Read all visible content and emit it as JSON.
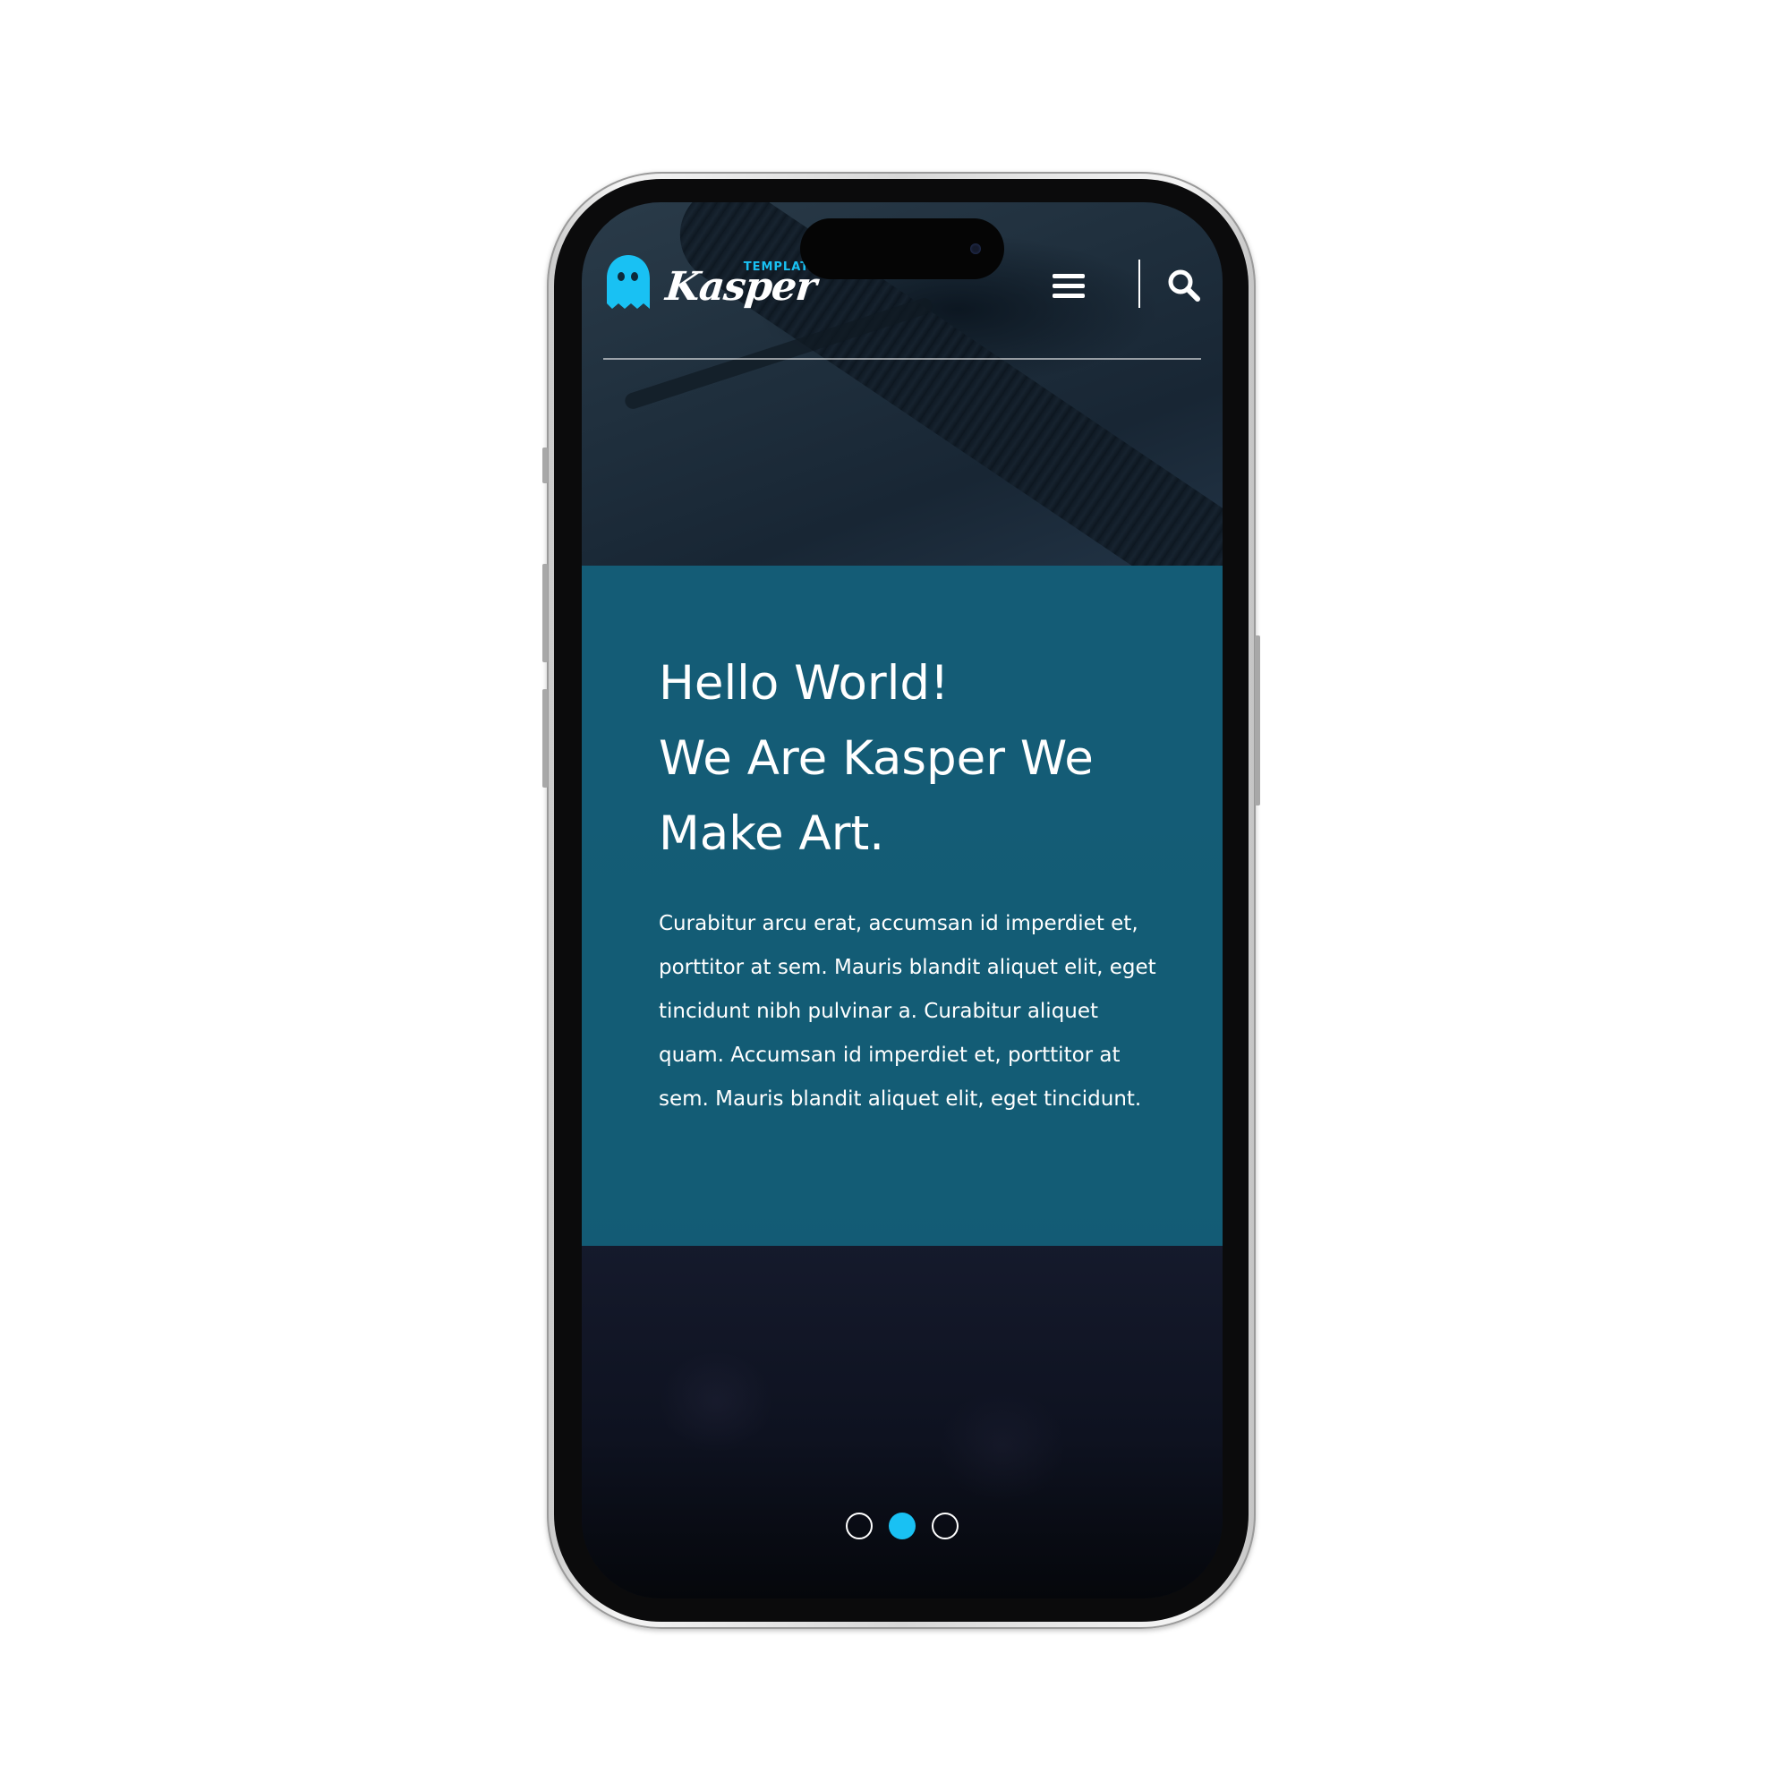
{
  "header": {
    "logo_main": "Kasper",
    "logo_sub": "TEMPLATE",
    "menu_icon": "hamburger-menu-icon",
    "search_icon": "search-icon"
  },
  "hero": {
    "title_lines": [
      "Hello World!",
      "We Are Kasper We",
      "Make Art."
    ],
    "description": "Curabitur arcu erat, accumsan id imperdiet et, porttitor at sem. Mauris blandit aliquet elit, eget tincidunt nibh pulvinar a. Curabitur aliquet quam. Accumsan id imperdiet et, porttitor at sem. Mauris blandit aliquet elit, eget tincidunt."
  },
  "carousel": {
    "slide_count": 3,
    "active_index": 1
  },
  "colors": {
    "accent": "#19c1f3",
    "panel": "#13617b",
    "text": "#ffffff"
  }
}
